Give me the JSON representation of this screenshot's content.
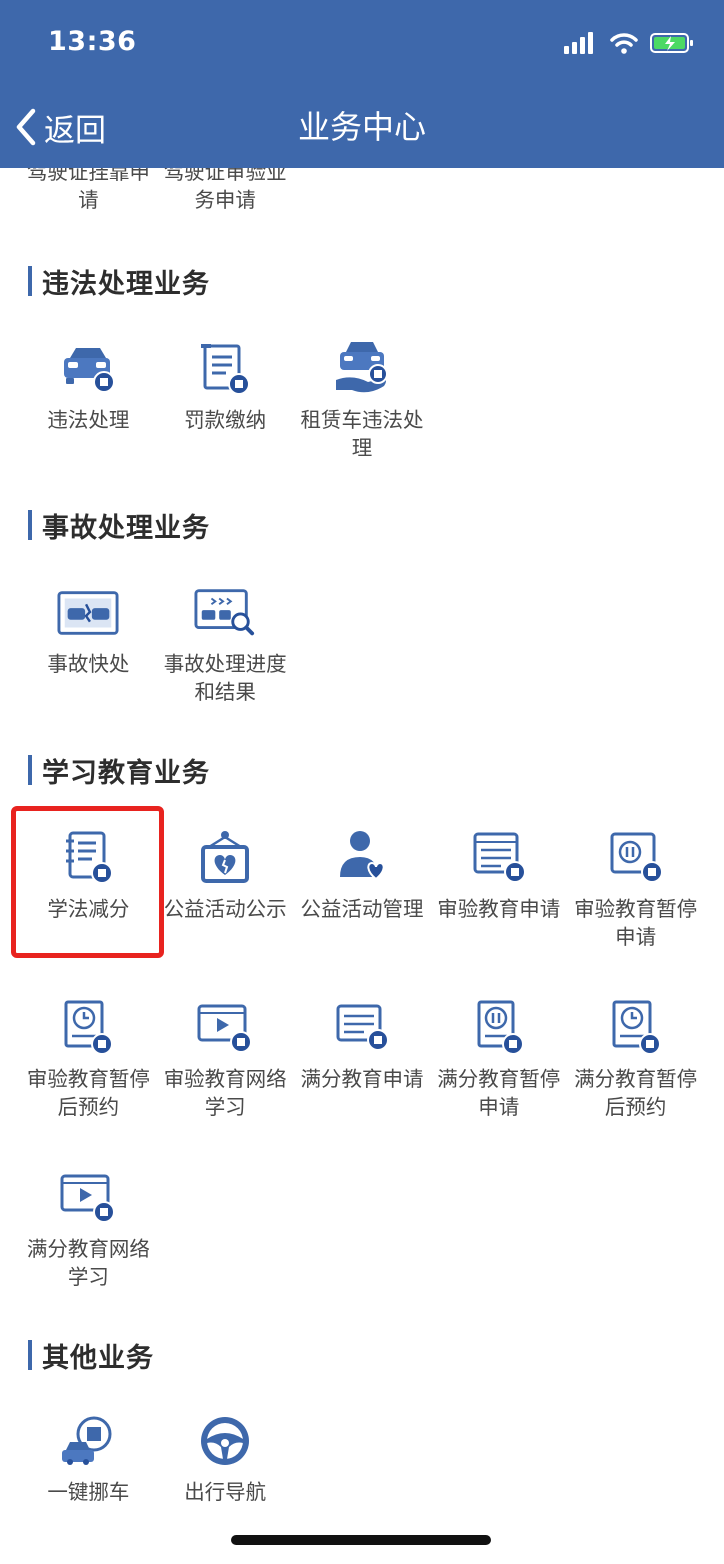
{
  "status": {
    "time": "13:36"
  },
  "nav": {
    "back_label": "返回",
    "title": "业务中心"
  },
  "partial_items": [
    {
      "label": "驾驶证挂靠申请"
    },
    {
      "label": "驾驶证审验业务申请"
    }
  ],
  "sections": [
    {
      "title": "违法处理业务",
      "items": [
        {
          "label": "违法处理",
          "icon": "car-violation-icon"
        },
        {
          "label": "罚款缴纳",
          "icon": "fine-document-icon"
        },
        {
          "label": "租赁车违法处理",
          "icon": "rental-car-violation-icon"
        }
      ]
    },
    {
      "title": "事故处理业务",
      "items": [
        {
          "label": "事故快处",
          "icon": "accident-quick-icon"
        },
        {
          "label": "事故处理进度和结果",
          "icon": "accident-progress-icon"
        }
      ]
    },
    {
      "title": "学习教育业务",
      "items": [
        {
          "label": "学法减分",
          "icon": "study-notebook-icon"
        },
        {
          "label": "公益活动公示",
          "icon": "charity-announcement-icon"
        },
        {
          "label": "公益活动管理",
          "icon": "charity-management-icon"
        },
        {
          "label": "审验教育申请",
          "icon": "review-education-icon"
        },
        {
          "label": "审验教育暂停申请",
          "icon": "review-pause-icon"
        },
        {
          "label": "审验教育暂停后预约",
          "icon": "review-appointment-icon"
        },
        {
          "label": "审验教育网络学习",
          "icon": "review-online-icon"
        },
        {
          "label": "满分教育申请",
          "icon": "fullscore-education-icon"
        },
        {
          "label": "满分教育暂停申请",
          "icon": "fullscore-pause-icon"
        },
        {
          "label": "满分教育暂停后预约",
          "icon": "fullscore-appointment-icon"
        },
        {
          "label": "满分教育网络学习",
          "icon": "fullscore-online-icon"
        }
      ]
    },
    {
      "title": "其他业务",
      "items": [
        {
          "label": "一键挪车",
          "icon": "move-car-icon"
        },
        {
          "label": "出行导航",
          "icon": "steering-wheel-icon"
        }
      ]
    }
  ],
  "colors": {
    "primary": "#3e68ab",
    "highlight": "#e8231f"
  }
}
